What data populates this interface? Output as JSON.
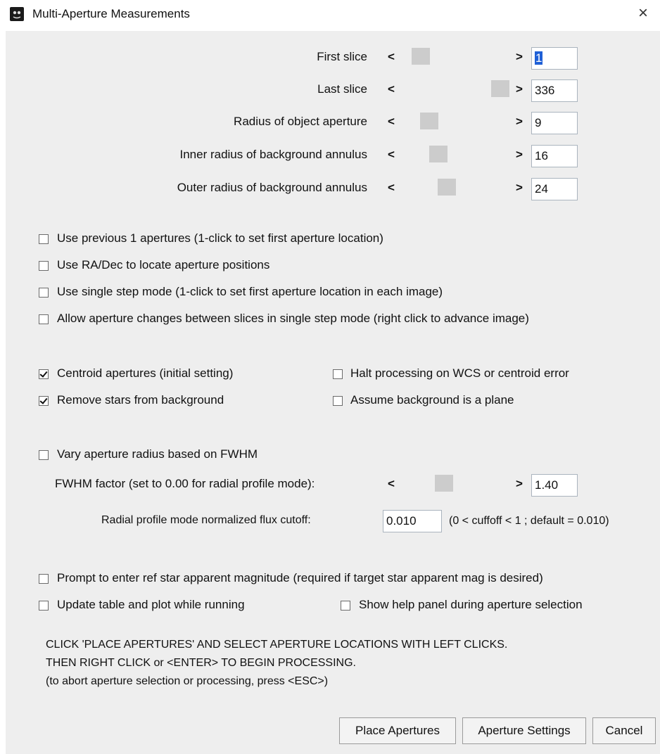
{
  "window": {
    "title": "Multi-Aperture Measurements",
    "close_glyph": "×",
    "app_icon": "imagej-app-icon"
  },
  "sliders": [
    {
      "label": "First slice",
      "value": "1",
      "value_selected": true,
      "position": 0.1
    },
    {
      "label": "Last slice",
      "value": "336",
      "value_selected": false,
      "position": 1.0
    },
    {
      "label": "Radius of object aperture",
      "value": "9",
      "value_selected": false,
      "position": 0.2
    },
    {
      "label": "Inner radius of background annulus",
      "value": "16",
      "value_selected": false,
      "position": 0.3
    },
    {
      "label": "Outer radius of background annulus",
      "value": "24",
      "value_selected": false,
      "position": 0.4
    }
  ],
  "arrows": {
    "left": "<",
    "right": ">"
  },
  "options_group1": [
    {
      "label": "Use previous 1 apertures (1-click to set first aperture location)",
      "checked": false
    },
    {
      "label": "Use RA/Dec to locate aperture positions",
      "checked": false
    },
    {
      "label": "Use single step mode (1-click to set first aperture location in each image)",
      "checked": false
    },
    {
      "label": "Allow aperture changes between slices in single step mode (right click to advance image)",
      "checked": false
    }
  ],
  "options_group2": {
    "left": [
      {
        "label": "Centroid apertures (initial setting)",
        "checked": true
      },
      {
        "label": "Remove stars from background",
        "checked": true
      }
    ],
    "right": [
      {
        "label": "Halt processing on WCS or centroid error",
        "checked": false
      },
      {
        "label": "Assume background is a plane",
        "checked": false
      }
    ]
  },
  "fwhm": {
    "vary_label": "Vary aperture radius based on FWHM",
    "vary_checked": false,
    "factor_label": "FWHM factor (set to 0.00 for radial profile mode):",
    "factor_value": "1.40",
    "factor_position": 0.4,
    "cutoff_label": "Radial profile mode normalized flux cutoff:",
    "cutoff_value": "0.010",
    "cutoff_hint": "(0 < cuffoff < 1 ; default = 0.010)"
  },
  "options_group3": {
    "prompt": {
      "label": "Prompt to enter ref star apparent magnitude (required if target star apparent mag is desired)",
      "checked": false
    },
    "update": {
      "label": "Update table and plot while running",
      "checked": false
    },
    "help": {
      "label": "Show help panel during aperture selection",
      "checked": false
    }
  },
  "instructions": [
    "CLICK 'PLACE APERTURES' AND SELECT APERTURE LOCATIONS WITH LEFT CLICKS.",
    "THEN RIGHT CLICK or <ENTER> TO BEGIN PROCESSING.",
    "(to abort aperture selection or processing, press <ESC>)"
  ],
  "buttons": {
    "place": "Place Apertures",
    "settings": "Aperture Settings",
    "cancel": "Cancel"
  }
}
